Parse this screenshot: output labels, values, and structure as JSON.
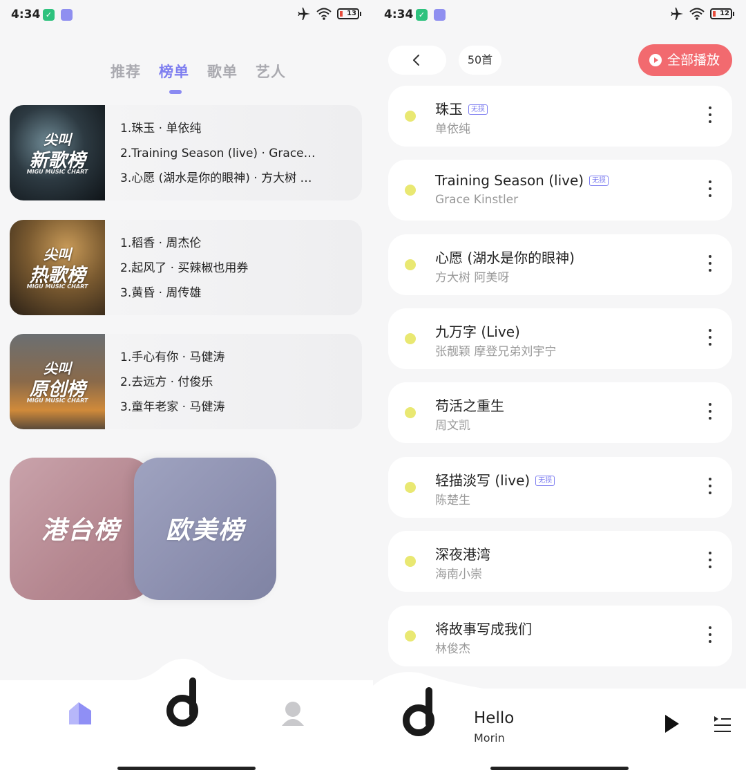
{
  "left": {
    "status": {
      "time": "4:34",
      "battery": "13"
    },
    "tabs": [
      "推荐",
      "榜单",
      "歌单",
      "艺人"
    ],
    "active_tab": 1,
    "charts": [
      {
        "cover_top": "尖叫",
        "cover_main": "新歌榜",
        "cover_sub": "MIGU MUSIC CHART",
        "songs": [
          "1.珠玉 · 单依纯",
          "2.Training Season (live) · Grace…",
          "3.心愿 (湖水是你的眼神) · 方大树 …"
        ]
      },
      {
        "cover_top": "尖叫",
        "cover_main": "热歌榜",
        "cover_sub": "MIGU MUSIC CHART",
        "songs": [
          "1.稻香 · 周杰伦",
          "2.起风了 · 买辣椒也用券",
          "3.黄昏 · 周传雄"
        ]
      },
      {
        "cover_top": "尖叫",
        "cover_main": "原创榜",
        "cover_sub": "MIGU MUSIC CHART",
        "songs": [
          "1.手心有你 · 马健涛",
          "2.去远方 · 付俊乐",
          "3.童年老家 · 马健涛"
        ]
      }
    ],
    "region_tiles": [
      "港台榜",
      "欧美榜"
    ],
    "nav": [
      "home-icon",
      "app-logo-icon",
      "profile-icon"
    ]
  },
  "right": {
    "status": {
      "time": "4:34",
      "battery": "12"
    },
    "count": "50首",
    "play_all": "全部播放",
    "lossless_badge": "无损",
    "songs": [
      {
        "title": "珠玉",
        "artist": "单依纯",
        "lossless": true
      },
      {
        "title": "Training Season (live)",
        "artist": "Grace Kinstler",
        "lossless": true
      },
      {
        "title": "心愿 (湖水是你的眼神)",
        "artist": "方大树 阿美呀",
        "lossless": false
      },
      {
        "title": "九万字 (Live)",
        "artist": "张靓颖 摩登兄弟刘宇宁",
        "lossless": false
      },
      {
        "title": "苟活之重生",
        "artist": "周文凯",
        "lossless": false
      },
      {
        "title": "轻描淡写 (live)",
        "artist": "陈楚生",
        "lossless": true
      },
      {
        "title": "深夜港湾",
        "artist": "海南小崇",
        "lossless": false
      },
      {
        "title": "将故事写成我们",
        "artist": "林俊杰",
        "lossless": false
      }
    ],
    "now_playing": {
      "title": "Hello",
      "artist": "Morin"
    },
    "colors": {
      "accent": "#7e7ef0",
      "play_all_bg": "#f26a6f",
      "dot": "#e9e872"
    }
  }
}
